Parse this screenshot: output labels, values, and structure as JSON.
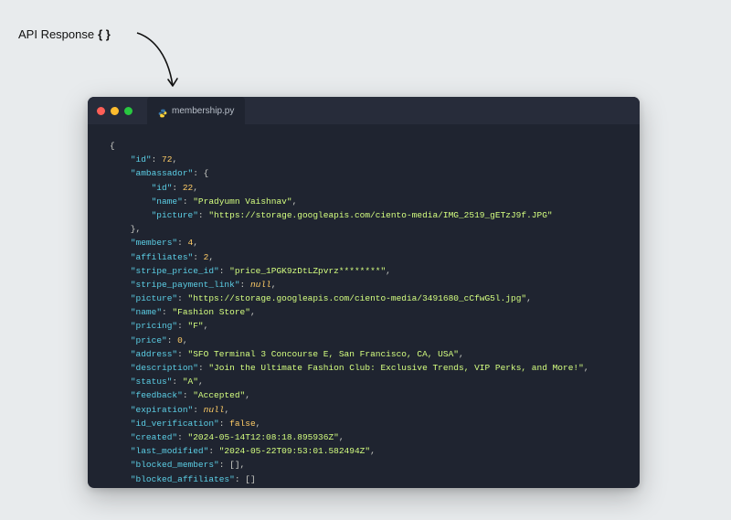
{
  "annotation": "API Response",
  "annotation_braces": "{ }",
  "tab_filename": "membership.py",
  "code_tokens": [
    {
      "t": "p",
      "v": "{\n"
    },
    {
      "t": "p",
      "v": "    "
    },
    {
      "t": "k",
      "v": "\"id\""
    },
    {
      "t": "p",
      "v": ": "
    },
    {
      "t": "n",
      "v": "72"
    },
    {
      "t": "p",
      "v": ",\n"
    },
    {
      "t": "p",
      "v": "    "
    },
    {
      "t": "k",
      "v": "\"ambassador\""
    },
    {
      "t": "p",
      "v": ": {\n"
    },
    {
      "t": "p",
      "v": "        "
    },
    {
      "t": "k",
      "v": "\"id\""
    },
    {
      "t": "p",
      "v": ": "
    },
    {
      "t": "n",
      "v": "22"
    },
    {
      "t": "p",
      "v": ",\n"
    },
    {
      "t": "p",
      "v": "        "
    },
    {
      "t": "k",
      "v": "\"name\""
    },
    {
      "t": "p",
      "v": ": "
    },
    {
      "t": "s",
      "v": "\"Pradyumn Vaishnav\""
    },
    {
      "t": "p",
      "v": ",\n"
    },
    {
      "t": "p",
      "v": "        "
    },
    {
      "t": "k",
      "v": "\"picture\""
    },
    {
      "t": "p",
      "v": ": "
    },
    {
      "t": "s",
      "v": "\"https://storage.googleapis.com/ciento-media/IMG_2519_gETzJ9f.JPG\""
    },
    {
      "t": "p",
      "v": "\n"
    },
    {
      "t": "p",
      "v": "    },\n"
    },
    {
      "t": "p",
      "v": "    "
    },
    {
      "t": "k",
      "v": "\"members\""
    },
    {
      "t": "p",
      "v": ": "
    },
    {
      "t": "n",
      "v": "4"
    },
    {
      "t": "p",
      "v": ",\n"
    },
    {
      "t": "p",
      "v": "    "
    },
    {
      "t": "k",
      "v": "\"affiliates\""
    },
    {
      "t": "p",
      "v": ": "
    },
    {
      "t": "n",
      "v": "2"
    },
    {
      "t": "p",
      "v": ",\n"
    },
    {
      "t": "p",
      "v": "    "
    },
    {
      "t": "k",
      "v": "\"stripe_price_id\""
    },
    {
      "t": "p",
      "v": ": "
    },
    {
      "t": "s",
      "v": "\"price_1PGK9zDtLZpvrz********\""
    },
    {
      "t": "p",
      "v": ",\n"
    },
    {
      "t": "p",
      "v": "    "
    },
    {
      "t": "k",
      "v": "\"stripe_payment_link\""
    },
    {
      "t": "p",
      "v": ": "
    },
    {
      "t": "nl",
      "v": "null"
    },
    {
      "t": "p",
      "v": ",\n"
    },
    {
      "t": "p",
      "v": "    "
    },
    {
      "t": "k",
      "v": "\"picture\""
    },
    {
      "t": "p",
      "v": ": "
    },
    {
      "t": "s",
      "v": "\"https://storage.googleapis.com/ciento-media/3491680_cCfwG5l.jpg\""
    },
    {
      "t": "p",
      "v": ",\n"
    },
    {
      "t": "p",
      "v": "    "
    },
    {
      "t": "k",
      "v": "\"name\""
    },
    {
      "t": "p",
      "v": ": "
    },
    {
      "t": "s",
      "v": "\"Fashion Store\""
    },
    {
      "t": "p",
      "v": ",\n"
    },
    {
      "t": "p",
      "v": "    "
    },
    {
      "t": "k",
      "v": "\"pricing\""
    },
    {
      "t": "p",
      "v": ": "
    },
    {
      "t": "s",
      "v": "\"F\""
    },
    {
      "t": "p",
      "v": ",\n"
    },
    {
      "t": "p",
      "v": "    "
    },
    {
      "t": "k",
      "v": "\"price\""
    },
    {
      "t": "p",
      "v": ": "
    },
    {
      "t": "n",
      "v": "0"
    },
    {
      "t": "p",
      "v": ",\n"
    },
    {
      "t": "p",
      "v": "    "
    },
    {
      "t": "k",
      "v": "\"address\""
    },
    {
      "t": "p",
      "v": ": "
    },
    {
      "t": "s",
      "v": "\"SFO Terminal 3 Concourse E, San Francisco, CA, USA\""
    },
    {
      "t": "p",
      "v": ",\n"
    },
    {
      "t": "p",
      "v": "    "
    },
    {
      "t": "k",
      "v": "\"description\""
    },
    {
      "t": "p",
      "v": ": "
    },
    {
      "t": "s",
      "v": "\"Join the Ultimate Fashion Club: Exclusive Trends, VIP Perks, and More!\""
    },
    {
      "t": "p",
      "v": ",\n"
    },
    {
      "t": "p",
      "v": "    "
    },
    {
      "t": "k",
      "v": "\"status\""
    },
    {
      "t": "p",
      "v": ": "
    },
    {
      "t": "s",
      "v": "\"A\""
    },
    {
      "t": "p",
      "v": ",\n"
    },
    {
      "t": "p",
      "v": "    "
    },
    {
      "t": "k",
      "v": "\"feedback\""
    },
    {
      "t": "p",
      "v": ": "
    },
    {
      "t": "s",
      "v": "\"Accepted\""
    },
    {
      "t": "p",
      "v": ",\n"
    },
    {
      "t": "p",
      "v": "    "
    },
    {
      "t": "k",
      "v": "\"expiration\""
    },
    {
      "t": "p",
      "v": ": "
    },
    {
      "t": "nl",
      "v": "null"
    },
    {
      "t": "p",
      "v": ",\n"
    },
    {
      "t": "p",
      "v": "    "
    },
    {
      "t": "k",
      "v": "\"id_verification\""
    },
    {
      "t": "p",
      "v": ": "
    },
    {
      "t": "b",
      "v": "false"
    },
    {
      "t": "p",
      "v": ",\n"
    },
    {
      "t": "p",
      "v": "    "
    },
    {
      "t": "k",
      "v": "\"created\""
    },
    {
      "t": "p",
      "v": ": "
    },
    {
      "t": "s",
      "v": "\"2024-05-14T12:08:18.895936Z\""
    },
    {
      "t": "p",
      "v": ",\n"
    },
    {
      "t": "p",
      "v": "    "
    },
    {
      "t": "k",
      "v": "\"last_modified\""
    },
    {
      "t": "p",
      "v": ": "
    },
    {
      "t": "s",
      "v": "\"2024-05-22T09:53:01.582494Z\""
    },
    {
      "t": "p",
      "v": ",\n"
    },
    {
      "t": "p",
      "v": "    "
    },
    {
      "t": "k",
      "v": "\"blocked_members\""
    },
    {
      "t": "p",
      "v": ": [],\n"
    },
    {
      "t": "p",
      "v": "    "
    },
    {
      "t": "k",
      "v": "\"blocked_affiliates\""
    },
    {
      "t": "p",
      "v": ": []\n"
    },
    {
      "t": "p",
      "v": "}"
    }
  ]
}
